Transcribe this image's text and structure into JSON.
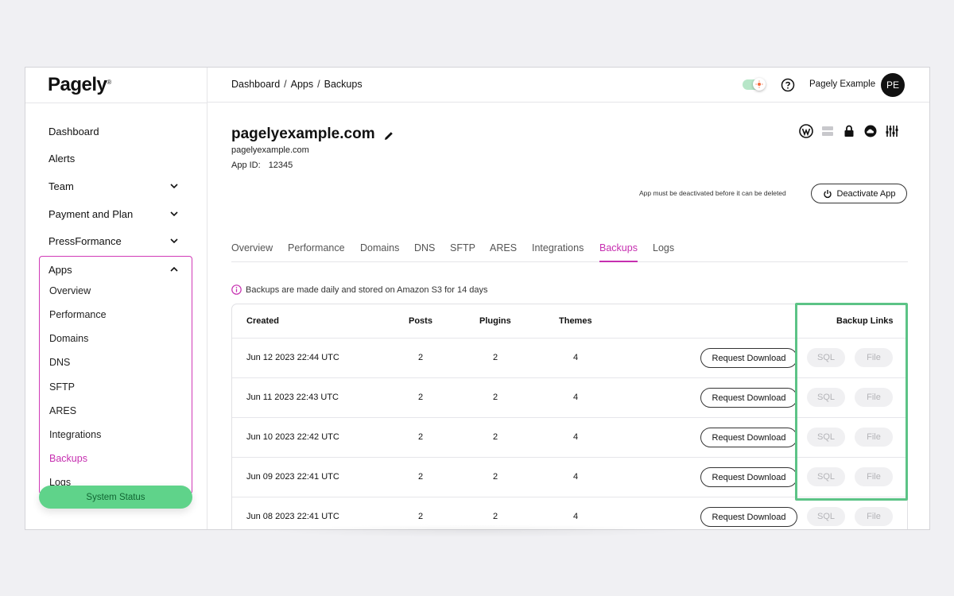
{
  "brand": {
    "logo": "Pagely",
    "logo_mark": "®"
  },
  "sidebar": {
    "items": [
      {
        "label": "Dashboard"
      },
      {
        "label": "Alerts"
      },
      {
        "label": "Team"
      },
      {
        "label": "Payment and Plan"
      },
      {
        "label": "PressFormance"
      }
    ],
    "apps": {
      "label": "Apps",
      "items": [
        {
          "label": "Overview"
        },
        {
          "label": "Performance"
        },
        {
          "label": "Domains"
        },
        {
          "label": "DNS"
        },
        {
          "label": "SFTP"
        },
        {
          "label": "ARES"
        },
        {
          "label": "Integrations"
        },
        {
          "label": "Backups"
        },
        {
          "label": "Logs"
        }
      ],
      "active": "Backups"
    },
    "system_status": "System Status"
  },
  "header": {
    "breadcrumb": [
      "Dashboard",
      "Apps",
      "Backups"
    ],
    "breadcrumb_sep": "/",
    "user_name": "Pagely Example",
    "avatar_initials": "PE"
  },
  "app": {
    "title": "pagelyexample.com",
    "domain": "pagelyexample.com",
    "id_label": "App ID:",
    "id_value": "12345",
    "deactivate_note": "App must be deactivated before it can be deleted",
    "deactivate_label": "Deactivate App"
  },
  "tabs": [
    "Overview",
    "Performance",
    "Domains",
    "DNS",
    "SFTP",
    "ARES",
    "Integrations",
    "Backups",
    "Logs"
  ],
  "active_tab": "Backups",
  "info_text": "Backups are made daily and stored on Amazon S3 for 14 days",
  "table": {
    "headers": {
      "created": "Created",
      "posts": "Posts",
      "plugins": "Plugins",
      "themes": "Themes",
      "links": "Backup Links"
    },
    "request_label": "Request Download",
    "sql_label": "SQL",
    "file_label": "File",
    "rows": [
      {
        "created": "Jun 12 2023 22:44 UTC",
        "posts": "2",
        "plugins": "2",
        "themes": "4"
      },
      {
        "created": "Jun 11 2023 22:43 UTC",
        "posts": "2",
        "plugins": "2",
        "themes": "4"
      },
      {
        "created": "Jun 10 2023 22:42 UTC",
        "posts": "2",
        "plugins": "2",
        "themes": "4"
      },
      {
        "created": "Jun 09 2023 22:41 UTC",
        "posts": "2",
        "plugins": "2",
        "themes": "4"
      },
      {
        "created": "Jun 08 2023 22:41 UTC",
        "posts": "2",
        "plugins": "2",
        "themes": "4"
      }
    ]
  },
  "colors": {
    "accent": "#c62fb0",
    "status_green": "#5fd38a",
    "highlight": "#5cc386"
  }
}
